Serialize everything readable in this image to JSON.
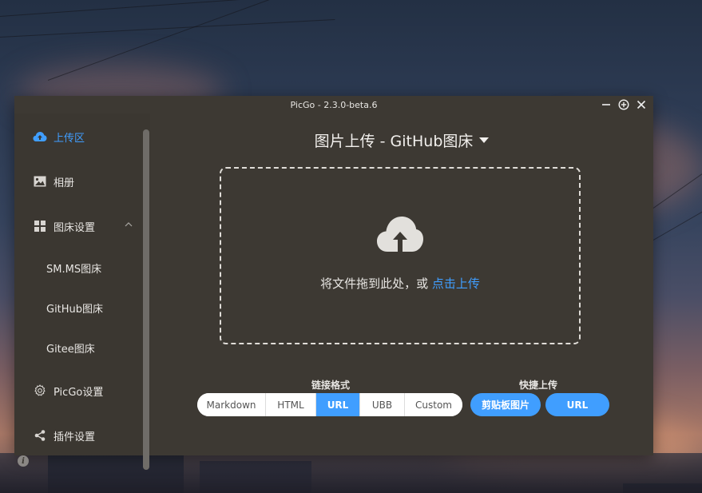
{
  "window": {
    "title": "PicGo - 2.3.0-beta.6",
    "controls": [
      "minimize-icon",
      "pin-icon",
      "close-icon"
    ]
  },
  "sidebar": {
    "items": [
      {
        "label": "上传区",
        "icon": "upload-cloud-icon",
        "active": true
      },
      {
        "label": "相册",
        "icon": "gallery-icon"
      },
      {
        "label": "图床设置",
        "icon": "grid-icon",
        "expanded": true
      },
      {
        "label": "SM.MS图床"
      },
      {
        "label": "GitHub图床"
      },
      {
        "label": "Gitee图床"
      },
      {
        "label": "PicGo设置",
        "icon": "gear-icon"
      },
      {
        "label": "插件设置",
        "icon": "share-icon"
      }
    ],
    "info_icon": "i"
  },
  "main": {
    "title": "图片上传 - GitHub图床",
    "dropzone": {
      "text": "将文件拖到此处，或 ",
      "link": "点击上传",
      "icon": "upload-cloud-icon"
    },
    "link_format": {
      "label": "链接格式",
      "options": [
        "Markdown",
        "HTML",
        "URL",
        "UBB",
        "Custom"
      ],
      "selected": "URL"
    },
    "quick_upload": {
      "label": "快捷上传",
      "buttons": [
        "剪贴板图片",
        "URL"
      ]
    }
  },
  "colors": {
    "accent": "#409eff",
    "window_bg": "#3d3933",
    "sidebar_bg": "#3b3731",
    "text": "#e8e6e3"
  }
}
